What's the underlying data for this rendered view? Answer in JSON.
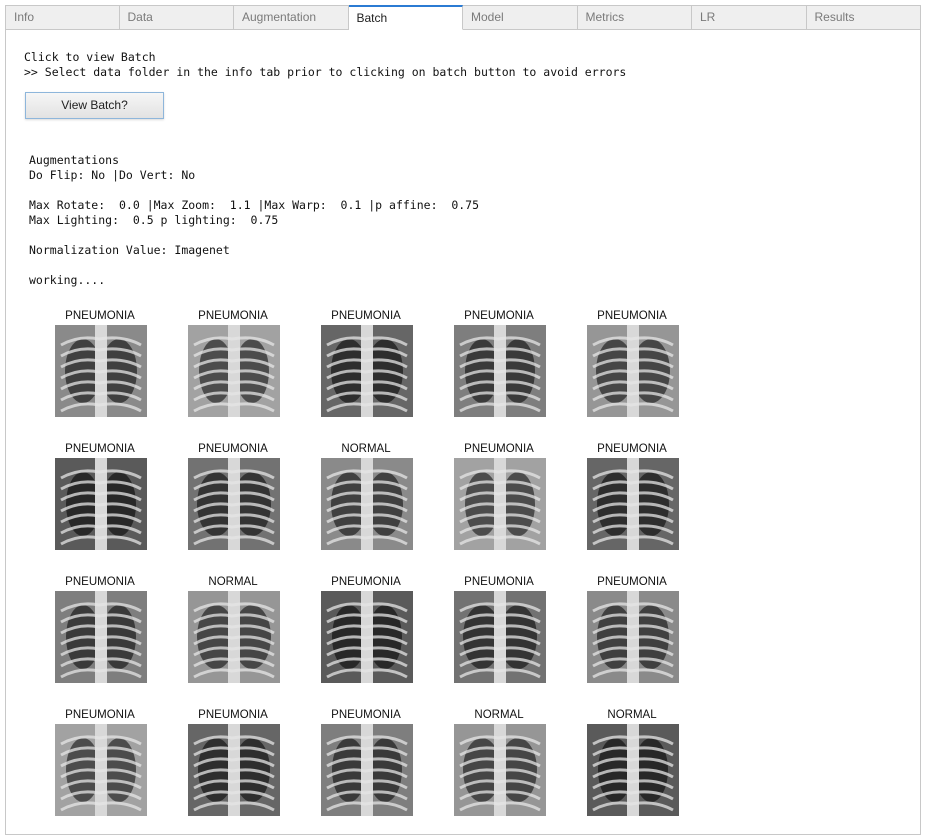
{
  "tabs": [
    {
      "label": "Info",
      "active": false
    },
    {
      "label": "Data",
      "active": false
    },
    {
      "label": "Augmentation",
      "active": false
    },
    {
      "label": "Batch",
      "active": true
    },
    {
      "label": "Model",
      "active": false
    },
    {
      "label": "Metrics",
      "active": false
    },
    {
      "label": "LR",
      "active": false
    },
    {
      "label": "Results",
      "active": false
    }
  ],
  "batch": {
    "intro_line1": "Click to view Batch",
    "intro_line2": ">> Select data folder in the info tab prior to clicking on batch button to avoid errors",
    "button_label": "View Batch?"
  },
  "output": {
    "augmentations_title": "Augmentations",
    "flip_line": "Do Flip: No |Do Vert: No",
    "rotate_line": "Max Rotate:  0.0 |Max Zoom:  1.1 |Max Warp:  0.1 |p affine:  0.75",
    "lighting_line": "Max Lighting:  0.5 p lighting:  0.75",
    "normalization_line": "Normalization Value: Imagenet",
    "status_line": "working...."
  },
  "images": [
    {
      "label": "PNEUMONIA"
    },
    {
      "label": "PNEUMONIA"
    },
    {
      "label": "PNEUMONIA"
    },
    {
      "label": "PNEUMONIA"
    },
    {
      "label": "PNEUMONIA"
    },
    {
      "label": "PNEUMONIA"
    },
    {
      "label": "PNEUMONIA"
    },
    {
      "label": "NORMAL"
    },
    {
      "label": "PNEUMONIA"
    },
    {
      "label": "PNEUMONIA"
    },
    {
      "label": "PNEUMONIA"
    },
    {
      "label": "NORMAL"
    },
    {
      "label": "PNEUMONIA"
    },
    {
      "label": "PNEUMONIA"
    },
    {
      "label": "PNEUMONIA"
    },
    {
      "label": "PNEUMONIA"
    },
    {
      "label": "PNEUMONIA"
    },
    {
      "label": "PNEUMONIA"
    },
    {
      "label": "NORMAL"
    },
    {
      "label": "NORMAL"
    }
  ]
}
